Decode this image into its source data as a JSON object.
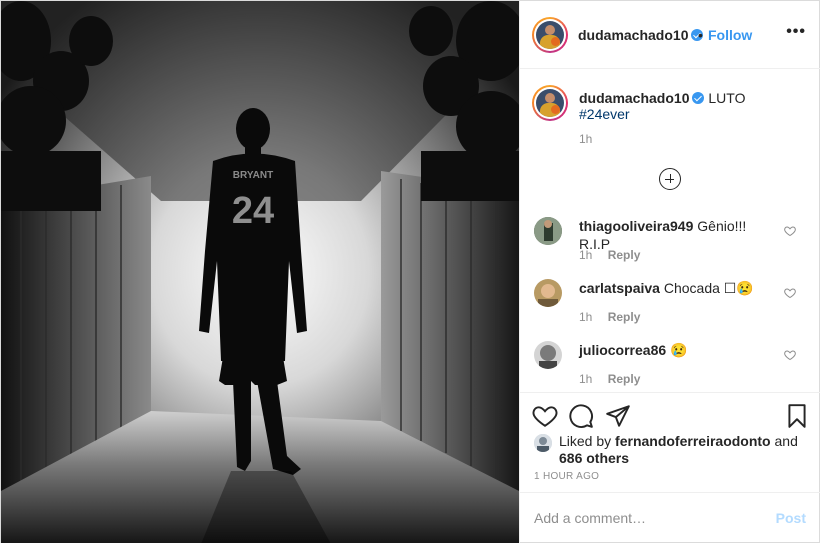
{
  "post": {
    "username": "dudamachado10",
    "follow_label": "Follow",
    "dot": "•",
    "more_label": "•••"
  },
  "caption": {
    "username": "dudamachado10",
    "text": "LUTO",
    "hashtag": "#24ever",
    "time": "1h"
  },
  "photo": {
    "jersey_name": "BRYANT",
    "jersey_number": "24"
  },
  "comments": [
    {
      "username": "thiagooliveira949",
      "text": "Gênio!!! R.I.P",
      "time": "1h",
      "reply_label": "Reply"
    },
    {
      "username": "carlatspaiva",
      "text": "Chocada ☐😢",
      "time": "1h",
      "reply_label": "Reply"
    },
    {
      "username": "juliocorrea86",
      "text": "😢",
      "time": "1h",
      "reply_label": "Reply"
    }
  ],
  "likes": {
    "prefix": "Liked by",
    "liker": "fernandoferreiraodonto",
    "and": "and",
    "others": "686 others"
  },
  "timestamp": "1 HOUR AGO",
  "add_comment": {
    "placeholder": "Add a comment…",
    "post_label": "Post"
  },
  "colors": {
    "link_blue": "#3897f0",
    "post_disabled": "#b3dbff",
    "muted": "#8e8e8e"
  }
}
